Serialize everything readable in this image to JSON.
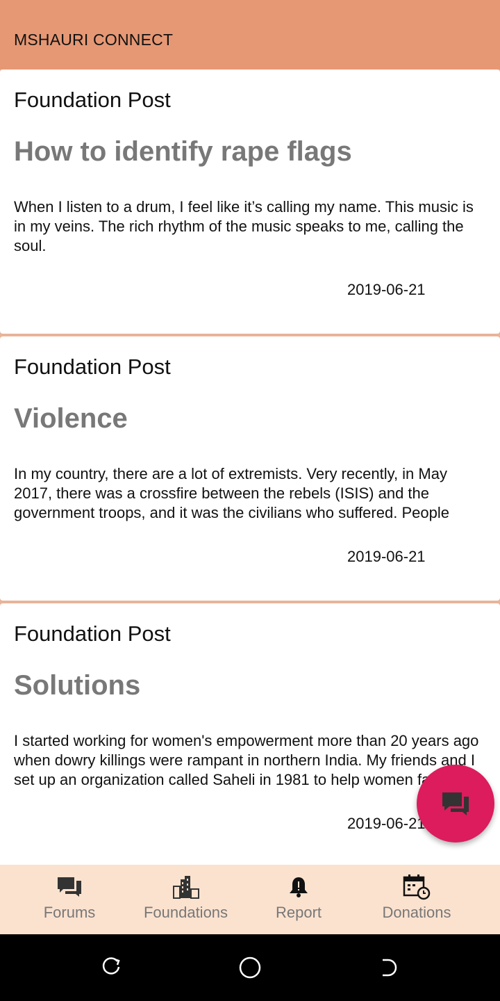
{
  "appbar": {
    "title": "MSHAURI CONNECT"
  },
  "posts": [
    {
      "kind": "Foundation Post",
      "title": "How to identify rape flags",
      "body": "When I listen to a drum, I feel like it’s calling my name. This music is in my veins.\n\nThe rich rhythm of the music speaks to me, calling the soul.",
      "date": "2019-06-21"
    },
    {
      "kind": "Foundation Post",
      "title": "Violence",
      "body": "In my country, there are a lot of extremists. Very recently, in May 2017, there was a crossfire between the rebels (ISIS) and the government troops, and it was the civilians who suffered. People were displaced from their homes, children lost schooling.",
      "date": "2019-06-21"
    },
    {
      "kind": "Foundation Post",
      "title": "Solutions",
      "body": "I started working for women's empowerment more than 20 years ago when dowry killings were rampant in northern India. My friends and I set up an organization called Saheli in 1981 to help women facing domestic violence.",
      "date": "2019-06-21"
    }
  ],
  "bottom_nav": {
    "items": [
      {
        "label": "Forums",
        "icon": "chat-bubbles-icon"
      },
      {
        "label": "Foundations",
        "icon": "buildings-icon"
      },
      {
        "label": "Report",
        "icon": "bell-alert-icon"
      },
      {
        "label": "Donations",
        "icon": "calendar-clock-icon"
      }
    ]
  },
  "fab": {
    "icon": "chat-icon",
    "color": "#dc1c5c"
  },
  "colors": {
    "appbar": "#e69874",
    "nav_bg": "#fbe2cf",
    "title_grey": "#787878"
  }
}
